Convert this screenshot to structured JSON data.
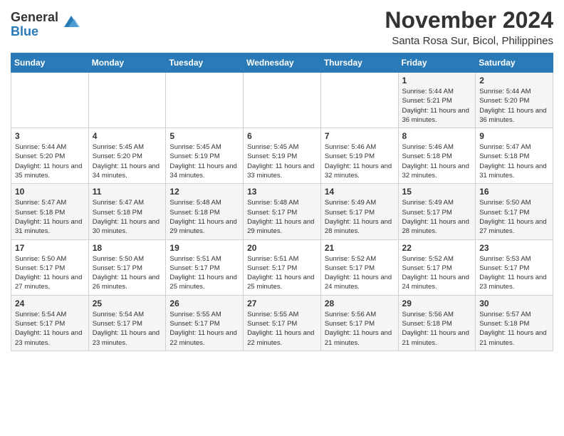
{
  "header": {
    "logo_general": "General",
    "logo_blue": "Blue",
    "month_title": "November 2024",
    "location": "Santa Rosa Sur, Bicol, Philippines"
  },
  "weekdays": [
    "Sunday",
    "Monday",
    "Tuesday",
    "Wednesday",
    "Thursday",
    "Friday",
    "Saturday"
  ],
  "weeks": [
    [
      {
        "day": null,
        "info": ""
      },
      {
        "day": null,
        "info": ""
      },
      {
        "day": null,
        "info": ""
      },
      {
        "day": null,
        "info": ""
      },
      {
        "day": null,
        "info": ""
      },
      {
        "day": "1",
        "info": "Sunrise: 5:44 AM\nSunset: 5:21 PM\nDaylight: 11 hours and 36 minutes."
      },
      {
        "day": "2",
        "info": "Sunrise: 5:44 AM\nSunset: 5:20 PM\nDaylight: 11 hours and 36 minutes."
      }
    ],
    [
      {
        "day": "3",
        "info": "Sunrise: 5:44 AM\nSunset: 5:20 PM\nDaylight: 11 hours and 35 minutes."
      },
      {
        "day": "4",
        "info": "Sunrise: 5:45 AM\nSunset: 5:20 PM\nDaylight: 11 hours and 34 minutes."
      },
      {
        "day": "5",
        "info": "Sunrise: 5:45 AM\nSunset: 5:19 PM\nDaylight: 11 hours and 34 minutes."
      },
      {
        "day": "6",
        "info": "Sunrise: 5:45 AM\nSunset: 5:19 PM\nDaylight: 11 hours and 33 minutes."
      },
      {
        "day": "7",
        "info": "Sunrise: 5:46 AM\nSunset: 5:19 PM\nDaylight: 11 hours and 32 minutes."
      },
      {
        "day": "8",
        "info": "Sunrise: 5:46 AM\nSunset: 5:18 PM\nDaylight: 11 hours and 32 minutes."
      },
      {
        "day": "9",
        "info": "Sunrise: 5:47 AM\nSunset: 5:18 PM\nDaylight: 11 hours and 31 minutes."
      }
    ],
    [
      {
        "day": "10",
        "info": "Sunrise: 5:47 AM\nSunset: 5:18 PM\nDaylight: 11 hours and 31 minutes."
      },
      {
        "day": "11",
        "info": "Sunrise: 5:47 AM\nSunset: 5:18 PM\nDaylight: 11 hours and 30 minutes."
      },
      {
        "day": "12",
        "info": "Sunrise: 5:48 AM\nSunset: 5:18 PM\nDaylight: 11 hours and 29 minutes."
      },
      {
        "day": "13",
        "info": "Sunrise: 5:48 AM\nSunset: 5:17 PM\nDaylight: 11 hours and 29 minutes."
      },
      {
        "day": "14",
        "info": "Sunrise: 5:49 AM\nSunset: 5:17 PM\nDaylight: 11 hours and 28 minutes."
      },
      {
        "day": "15",
        "info": "Sunrise: 5:49 AM\nSunset: 5:17 PM\nDaylight: 11 hours and 28 minutes."
      },
      {
        "day": "16",
        "info": "Sunrise: 5:50 AM\nSunset: 5:17 PM\nDaylight: 11 hours and 27 minutes."
      }
    ],
    [
      {
        "day": "17",
        "info": "Sunrise: 5:50 AM\nSunset: 5:17 PM\nDaylight: 11 hours and 27 minutes."
      },
      {
        "day": "18",
        "info": "Sunrise: 5:50 AM\nSunset: 5:17 PM\nDaylight: 11 hours and 26 minutes."
      },
      {
        "day": "19",
        "info": "Sunrise: 5:51 AM\nSunset: 5:17 PM\nDaylight: 11 hours and 25 minutes."
      },
      {
        "day": "20",
        "info": "Sunrise: 5:51 AM\nSunset: 5:17 PM\nDaylight: 11 hours and 25 minutes."
      },
      {
        "day": "21",
        "info": "Sunrise: 5:52 AM\nSunset: 5:17 PM\nDaylight: 11 hours and 24 minutes."
      },
      {
        "day": "22",
        "info": "Sunrise: 5:52 AM\nSunset: 5:17 PM\nDaylight: 11 hours and 24 minutes."
      },
      {
        "day": "23",
        "info": "Sunrise: 5:53 AM\nSunset: 5:17 PM\nDaylight: 11 hours and 23 minutes."
      }
    ],
    [
      {
        "day": "24",
        "info": "Sunrise: 5:54 AM\nSunset: 5:17 PM\nDaylight: 11 hours and 23 minutes."
      },
      {
        "day": "25",
        "info": "Sunrise: 5:54 AM\nSunset: 5:17 PM\nDaylight: 11 hours and 23 minutes."
      },
      {
        "day": "26",
        "info": "Sunrise: 5:55 AM\nSunset: 5:17 PM\nDaylight: 11 hours and 22 minutes."
      },
      {
        "day": "27",
        "info": "Sunrise: 5:55 AM\nSunset: 5:17 PM\nDaylight: 11 hours and 22 minutes."
      },
      {
        "day": "28",
        "info": "Sunrise: 5:56 AM\nSunset: 5:17 PM\nDaylight: 11 hours and 21 minutes."
      },
      {
        "day": "29",
        "info": "Sunrise: 5:56 AM\nSunset: 5:18 PM\nDaylight: 11 hours and 21 minutes."
      },
      {
        "day": "30",
        "info": "Sunrise: 5:57 AM\nSunset: 5:18 PM\nDaylight: 11 hours and 21 minutes."
      }
    ]
  ]
}
